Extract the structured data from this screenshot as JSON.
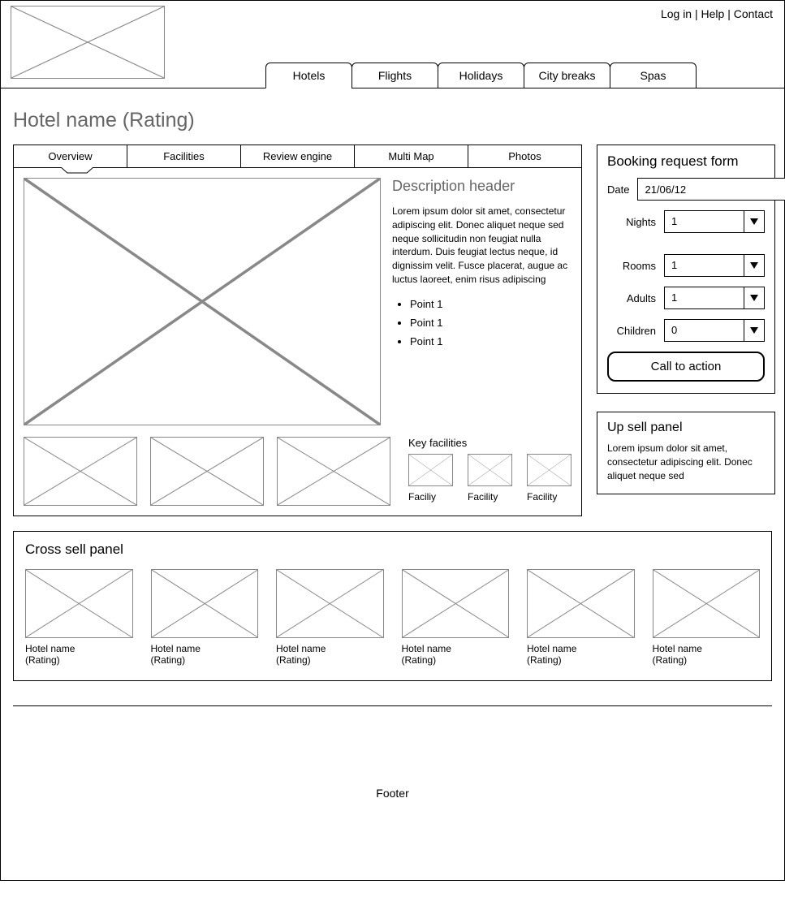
{
  "top_links": {
    "login": "Log in",
    "help": "Help",
    "contact": "Contact"
  },
  "main_nav": [
    "Hotels",
    "Flights",
    "Holidays",
    "City breaks",
    "Spas"
  ],
  "page_title": "Hotel name (Rating)",
  "detail_tabs": [
    "Overview",
    "Facilities",
    "Review engine",
    "Multi Map",
    "Photos"
  ],
  "description": {
    "header": "Description header",
    "body": "Lorem ipsum dolor sit amet, consectetur adipiscing elit. Donec aliquet neque sed neque sollicitudin non feugiat nulla interdum. Duis feugiat lectus neque, id dignissim velit. Fusce placerat, augue ac luctus laoreet, enim risus adipiscing",
    "points": [
      "Point 1",
      "Point 1",
      "Point 1"
    ]
  },
  "key_facilities": {
    "title": "Key facilities",
    "items": [
      "Faciliy",
      "Facility",
      "Facility"
    ]
  },
  "booking": {
    "title": "Booking request form",
    "labels": {
      "date": "Date",
      "nights": "Nights",
      "rooms": "Rooms",
      "adults": "Adults",
      "children": "Children"
    },
    "values": {
      "date": "21/06/12",
      "nights": "1",
      "rooms": "1",
      "adults": "1",
      "children": "0"
    },
    "cta": "Call to action"
  },
  "upsell": {
    "title": "Up sell panel",
    "body": "Lorem ipsum dolor sit amet, consectetur adipiscing elit. Donec aliquet neque sed"
  },
  "cross_sell": {
    "title": "Cross sell panel",
    "items": [
      {
        "name": "Hotel name",
        "rating": "(Rating)"
      },
      {
        "name": "Hotel name",
        "rating": "(Rating)"
      },
      {
        "name": "Hotel name",
        "rating": "(Rating)"
      },
      {
        "name": "Hotel name",
        "rating": "(Rating)"
      },
      {
        "name": "Hotel name",
        "rating": "(Rating)"
      },
      {
        "name": "Hotel name",
        "rating": "(Rating)"
      }
    ]
  },
  "footer": "Footer"
}
